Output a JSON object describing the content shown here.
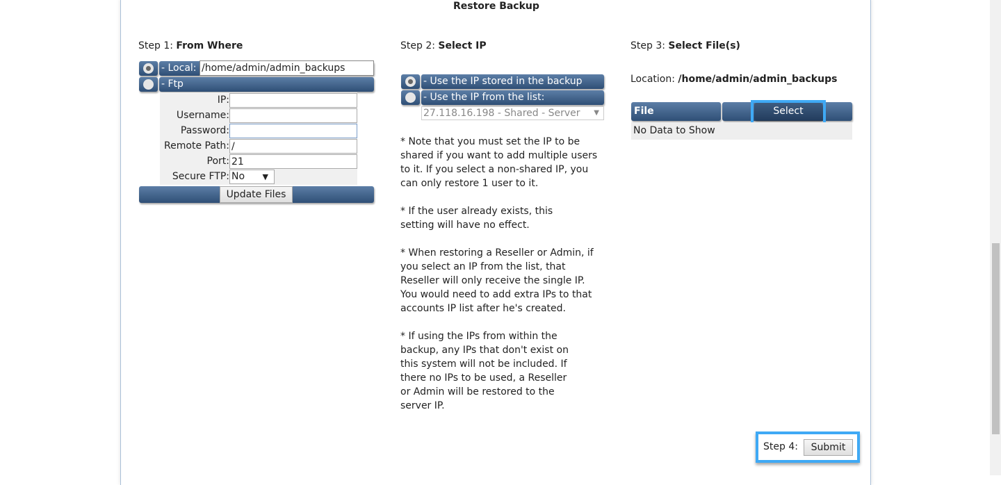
{
  "title": "Restore Backup",
  "step1": {
    "prefix": "Step 1:",
    "label": "From Where",
    "local_label": "- Local:",
    "local_path": "/home/admin/admin_backups",
    "ftp_label": "- Ftp",
    "selected": "local",
    "fields": [
      {
        "label": "IP:",
        "value": ""
      },
      {
        "label": "Username:",
        "value": ""
      },
      {
        "label": "Password:",
        "value": ""
      },
      {
        "label": "Remote Path:",
        "value": "/"
      },
      {
        "label": "Port:",
        "value": "21"
      }
    ],
    "secure_label": "Secure FTP:",
    "secure_value": "No",
    "update_button": "Update Files"
  },
  "step2": {
    "prefix": "Step 2:",
    "label": "Select IP",
    "opt1": "- Use the IP stored in the backup",
    "opt2": "- Use the IP from the list:",
    "selected": "opt1",
    "ip_select": "27.118.16.198 - Shared - Server",
    "notes": [
      "* Note that you must set the IP to be shared if you want to add multiple users to it. If you select a non-shared IP, you can only restore 1 user to it.",
      "* If the user already exists, this setting will have no effect.",
      "* When restoring a Reseller or Admin, if you select an IP from the list, that Reseller will only receive the single IP. You would need to add extra IPs to that accounts IP list after he's created.",
      "* If using the IPs from within the backup, any IPs that don't exist on this system will not be included. If there no IPs to be used, a Reseller or Admin will be restored to the server IP."
    ]
  },
  "step3": {
    "prefix": "Step 3:",
    "label": "Select File(s)",
    "location_label": "Location:",
    "location_value": "/home/admin/admin_backups",
    "col_file": "File",
    "select_button": "Select",
    "empty": "No Data to Show"
  },
  "step4": {
    "prefix": "Step 4:",
    "submit": "Submit"
  },
  "colors": {
    "bar": "#3d5f88",
    "highlight": "#3fa9f5"
  }
}
